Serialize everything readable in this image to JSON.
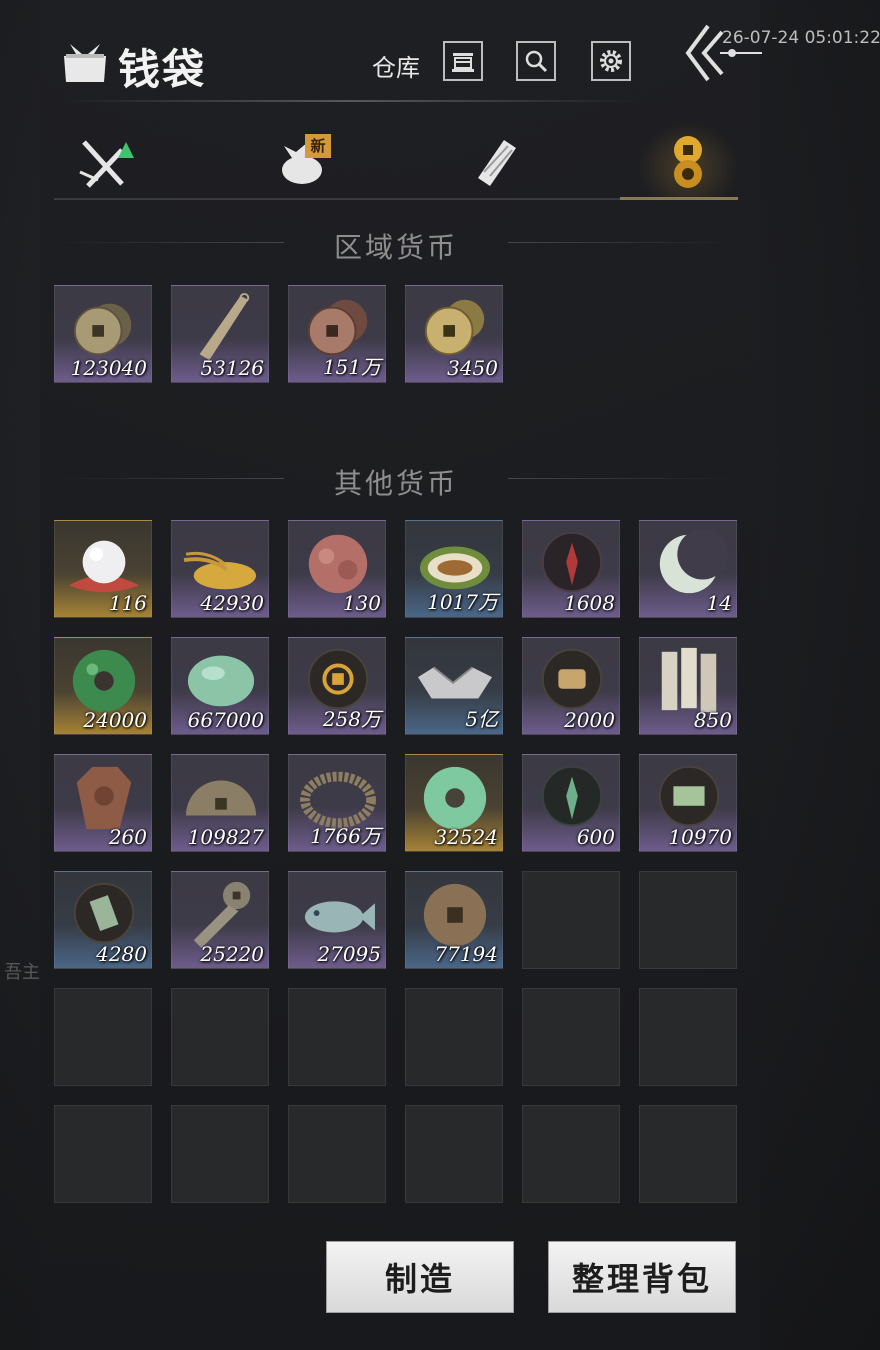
{
  "header": {
    "title": "钱袋",
    "storage_label": "仓库",
    "clock": "26-07-24 05:01:22"
  },
  "tabs": [
    {
      "icon": "crossed-swords-icon",
      "active": false
    },
    {
      "icon": "bundle-icon",
      "active": false,
      "badge": "新"
    },
    {
      "icon": "scroll-icon",
      "active": false
    },
    {
      "icon": "coins-icon",
      "active": true
    }
  ],
  "sections": {
    "regional": "区域货币",
    "other": "其他货币"
  },
  "regional_items": [
    {
      "icon": "copper-coin-stack-icon",
      "qty": "123040",
      "rarity": "purple"
    },
    {
      "icon": "knife-coin-icon",
      "qty": "53126",
      "rarity": "purple"
    },
    {
      "icon": "red-coin-stack-icon",
      "qty": "151万",
      "rarity": "purple"
    },
    {
      "icon": "gold-coin-stack-icon",
      "qty": "3450",
      "rarity": "purple"
    }
  ],
  "other_items": [
    {
      "icon": "pearl-icon",
      "qty": "116",
      "rarity": "gold"
    },
    {
      "icon": "grain-pile-icon",
      "qty": "42930",
      "rarity": "purple"
    },
    {
      "icon": "red-stone-icon",
      "qty": "130",
      "rarity": "purple"
    },
    {
      "icon": "melon-icon",
      "qty": "1017万",
      "rarity": "blue"
    },
    {
      "icon": "red-sigil-icon",
      "qty": "1608",
      "rarity": "purple"
    },
    {
      "icon": "crescent-jade-icon",
      "qty": "14",
      "rarity": "purple"
    },
    {
      "icon": "green-jade-ring-icon",
      "qty": "24000",
      "rarity": "gold"
    },
    {
      "icon": "jade-pebble-icon",
      "qty": "667000",
      "rarity": "purple"
    },
    {
      "icon": "gold-emblem-icon",
      "qty": "258万",
      "rarity": "purple"
    },
    {
      "icon": "silver-ingot-icon",
      "qty": "5亿",
      "rarity": "blue"
    },
    {
      "icon": "scroll-sigil-icon",
      "qty": "2000",
      "rarity": "purple"
    },
    {
      "icon": "bamboo-slips-icon",
      "qty": "850",
      "rarity": "purple"
    },
    {
      "icon": "bronze-plaque-icon",
      "qty": "260",
      "rarity": "purple"
    },
    {
      "icon": "half-coin-icon",
      "qty": "109827",
      "rarity": "purple"
    },
    {
      "icon": "coin-string-icon",
      "qty": "1766万",
      "rarity": "purple"
    },
    {
      "icon": "jade-bi-icon",
      "qty": "32524",
      "rarity": "gold"
    },
    {
      "icon": "green-sigil-icon",
      "qty": "600",
      "rarity": "purple"
    },
    {
      "icon": "map-sigil-icon",
      "qty": "10970",
      "rarity": "purple"
    },
    {
      "icon": "token-sigil-icon",
      "qty": "4280",
      "rarity": "blue"
    },
    {
      "icon": "spade-coin-icon",
      "qty": "25220",
      "rarity": "purple"
    },
    {
      "icon": "jade-fish-icon",
      "qty": "27095",
      "rarity": "purple"
    },
    {
      "icon": "bronze-coin-icon",
      "qty": "77194",
      "rarity": "blue"
    }
  ],
  "buttons": {
    "craft": "制造",
    "sort": "整理背包"
  },
  "background_text": "吾主"
}
